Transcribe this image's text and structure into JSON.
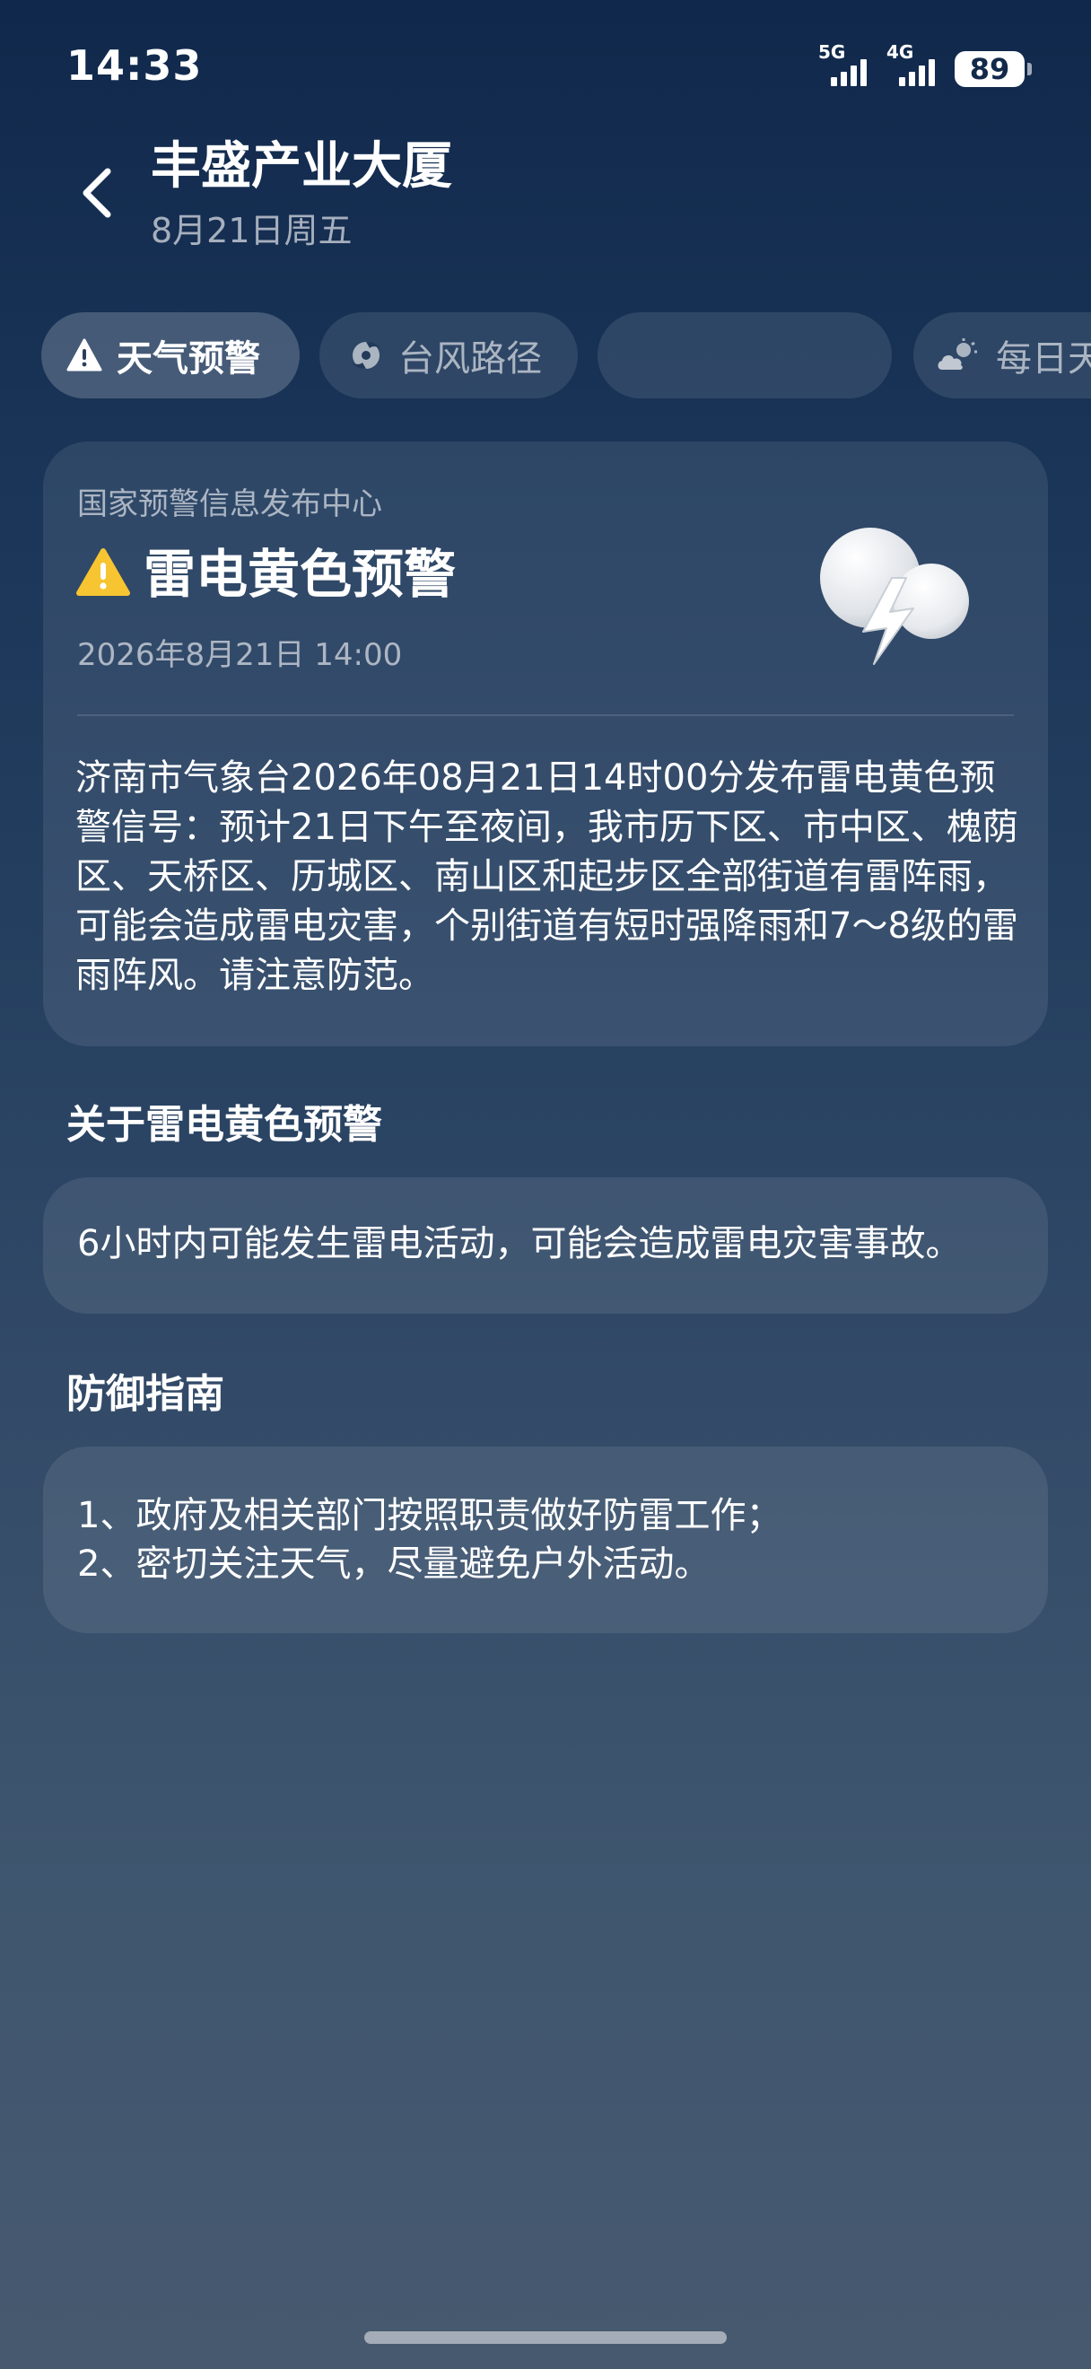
{
  "status_bar": {
    "time": "14:33",
    "network_1": "5G",
    "network_2": "4G",
    "battery": "89"
  },
  "header": {
    "title": "丰盛产业大厦",
    "subtitle": "8月21日周五"
  },
  "tabs": [
    {
      "label": "天气预警",
      "icon": "warning-triangle-icon",
      "active": true
    },
    {
      "label": "台风路径",
      "icon": "typhoon-icon",
      "active": false
    },
    {
      "label": "",
      "icon": "",
      "active": false
    },
    {
      "label": "每日天",
      "icon": "sun-cloud-icon",
      "active": false
    }
  ],
  "warning": {
    "issuer": "国家预警信息发布中心",
    "title": "雷电黄色预警",
    "time": "2026年8月21日 14:00",
    "body": "济南市气象台2026年08月21日14时00分发布雷电黄色预警信号：预计21日下午至夜间，我市历下区、市中区、槐荫区、天桥区、历城区、南山区和起步区全部街道有雷阵雨，可能会造成雷电灾害，个别街道有短时强降雨和7～8级的雷雨阵风。请注意防范。",
    "color": "#f7c531"
  },
  "about": {
    "heading": "关于雷电黄色预警",
    "text": "6小时内可能发生雷电活动，可能会造成雷电灾害事故。"
  },
  "guide": {
    "heading": "防御指南",
    "items": [
      "1、政府及相关部门按照职责做好防雷工作；",
      "2、密切关注天气，尽量避免户外活动。"
    ]
  }
}
